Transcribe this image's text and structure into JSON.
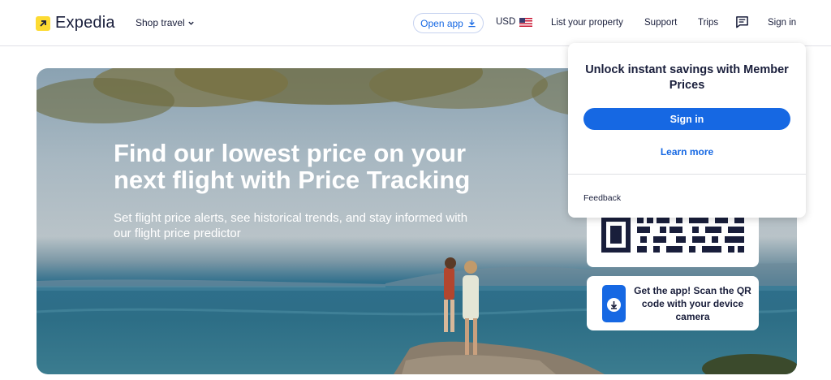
{
  "header": {
    "logo_text": "Expedia",
    "shop_travel": "Shop travel",
    "open_app": "Open app",
    "currency": "USD",
    "list_property": "List your property",
    "support": "Support",
    "trips": "Trips",
    "sign_in": "Sign in",
    "icons": [
      "arrow-up-right-icon",
      "chevron-down-icon",
      "download-icon",
      "us-flag-icon",
      "message-icon"
    ]
  },
  "hero": {
    "title": "Find our lowest price on your next flight with Price Tracking",
    "subtitle": "Set flight price alerts, see historical trends, and stay informed with our flight price predictor"
  },
  "app_promo": {
    "text": "Get the app! Scan the QR code with your device camera",
    "icons": [
      "qr-code",
      "phone-download-icon"
    ]
  },
  "popup": {
    "title": "Unlock instant savings with Member Prices",
    "sign_in": "Sign in",
    "learn_more": "Learn more",
    "feedback": "Feedback"
  },
  "colors": {
    "brand_blue": "#1668e3",
    "logo_yellow": "#fddb32",
    "text_dark": "#191e3b"
  }
}
